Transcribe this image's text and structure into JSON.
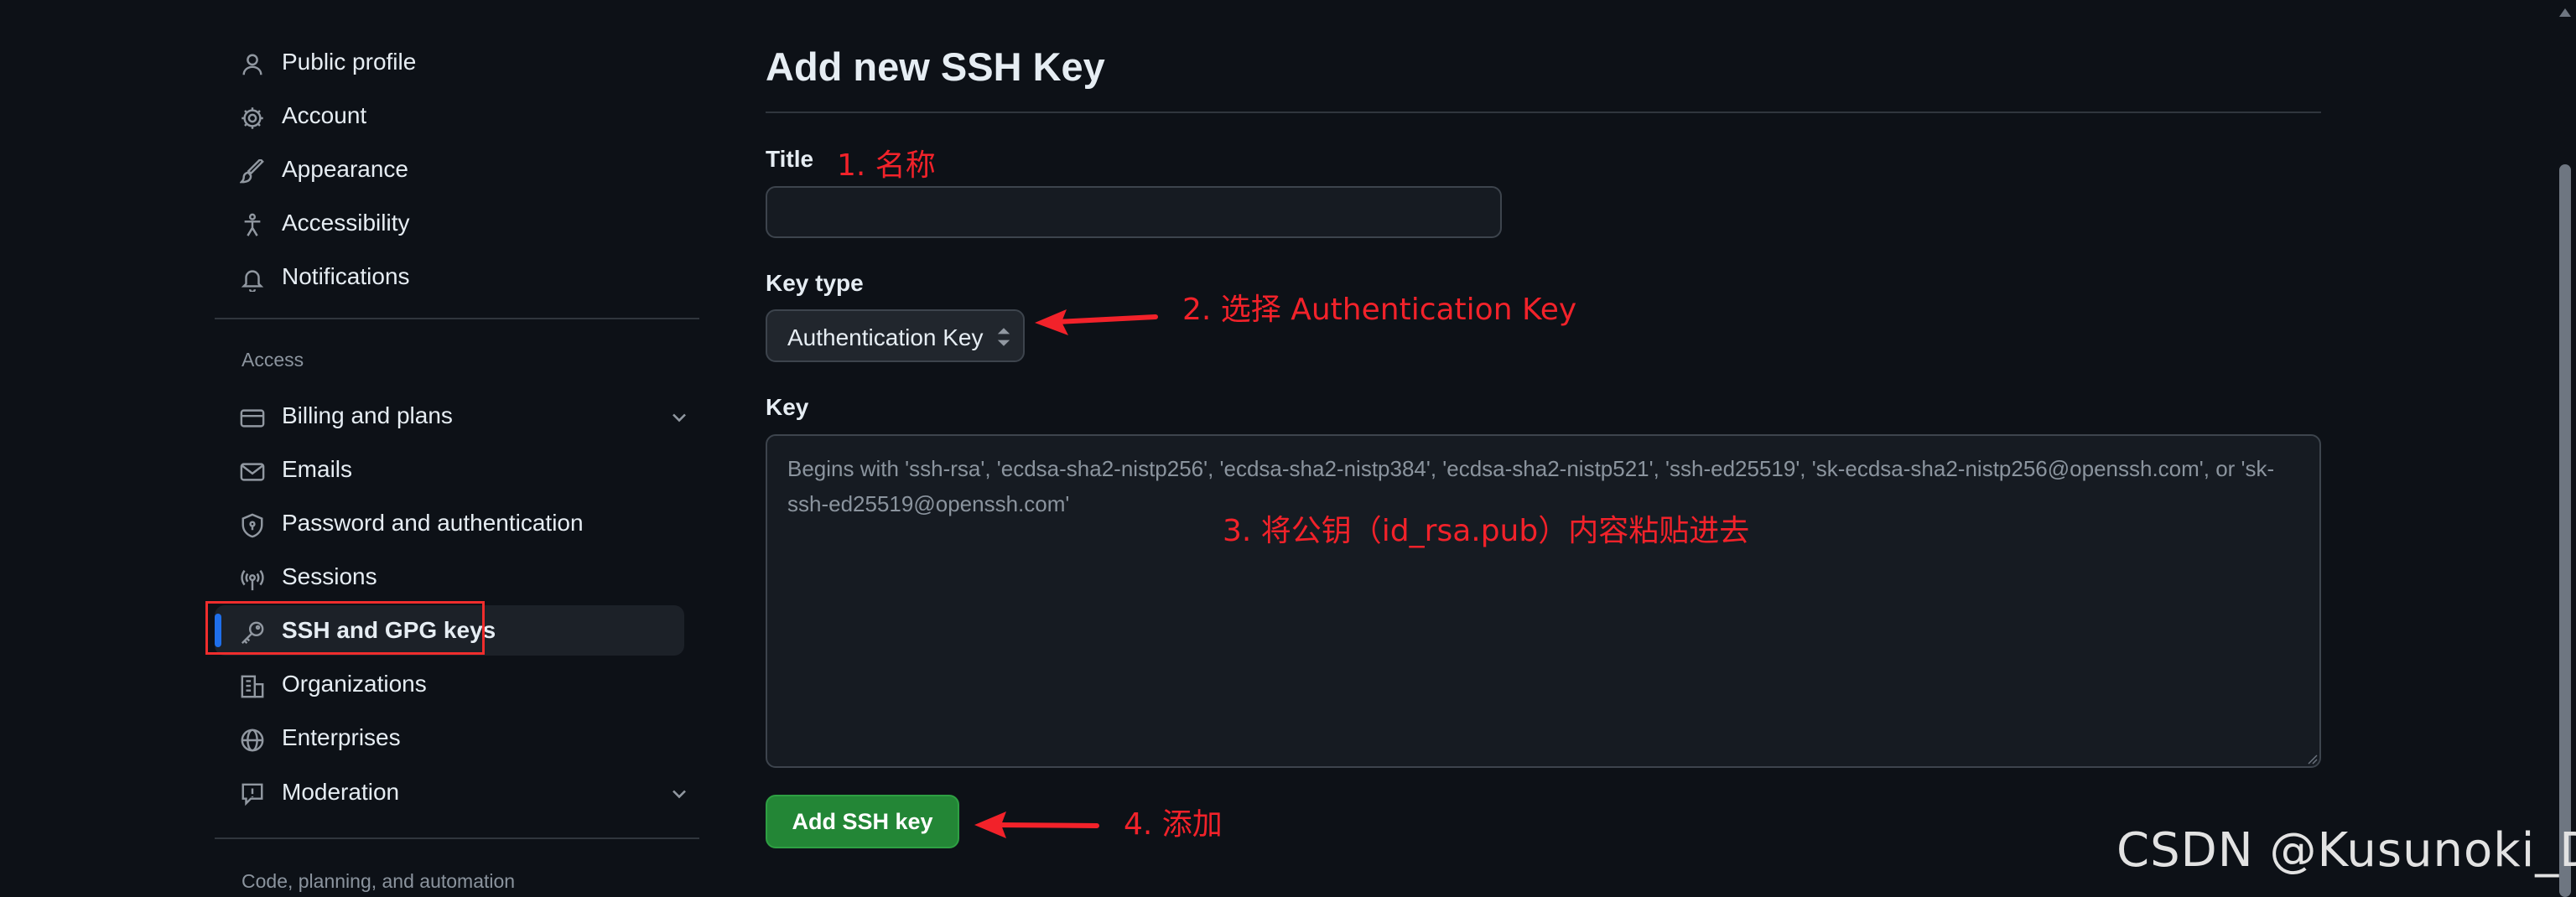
{
  "sidebar": {
    "group1": [
      {
        "label": "Public profile",
        "icon": "person-icon"
      },
      {
        "label": "Account",
        "icon": "gear-icon"
      },
      {
        "label": "Appearance",
        "icon": "paintbrush-icon"
      },
      {
        "label": "Accessibility",
        "icon": "accessibility-icon"
      },
      {
        "label": "Notifications",
        "icon": "bell-icon"
      }
    ],
    "access_heading": "Access",
    "access": [
      {
        "label": "Billing and plans",
        "icon": "credit-card-icon"
      },
      {
        "label": "Emails",
        "icon": "mail-icon"
      },
      {
        "label": "Password and authentication",
        "icon": "shield-lock-icon"
      },
      {
        "label": "Sessions",
        "icon": "broadcast-icon"
      },
      {
        "label": "SSH and GPG keys",
        "icon": "key-icon"
      },
      {
        "label": "Organizations",
        "icon": "organization-icon"
      },
      {
        "label": "Enterprises",
        "icon": "globe-icon"
      },
      {
        "label": "Moderation",
        "icon": "report-icon"
      }
    ],
    "code_heading": "Code, planning, and automation"
  },
  "main": {
    "title": "Add new SSH Key",
    "title_label": "Title",
    "title_value": "",
    "key_type_label": "Key type",
    "key_type_value": "Authentication Key",
    "key_label": "Key",
    "key_placeholder": "Begins with 'ssh-rsa', 'ecdsa-sha2-nistp256', 'ecdsa-sha2-nistp384', 'ecdsa-sha2-nistp521', 'ssh-ed25519', 'sk-ecdsa-sha2-nistp256@openssh.com', or 'sk-ssh-ed25519@openssh.com'",
    "add_button": "Add SSH key"
  },
  "annotations": {
    "step1": "1. 名称",
    "step2": "2. 选择 Authentication Key",
    "step3": "3. 将公钥（id_rsa.pub）内容粘贴进去",
    "step4": "4. 添加",
    "color": "#f2222a"
  },
  "watermark": "CSDN @Kusunoki_D",
  "colors": {
    "background": "#0d1117",
    "accent": "#1f6feb",
    "button": "#238636"
  }
}
